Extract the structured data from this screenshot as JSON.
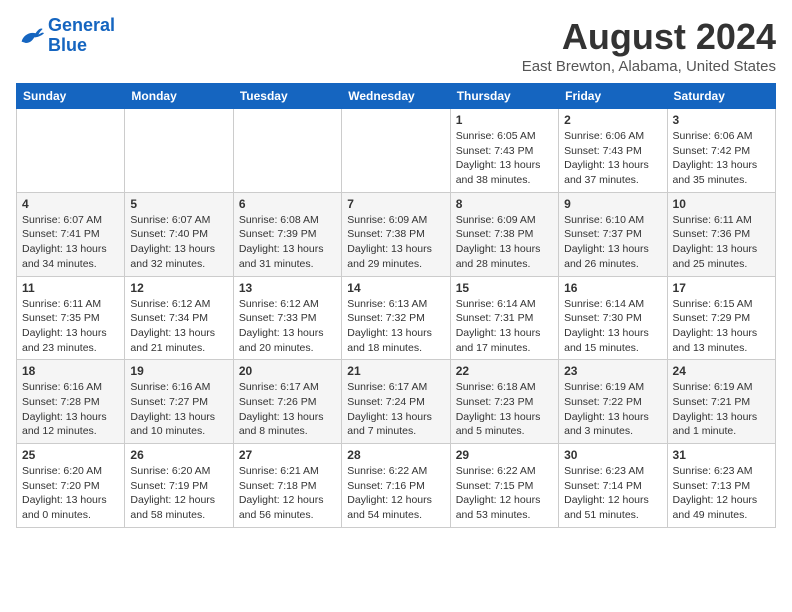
{
  "header": {
    "logo": {
      "line1": "General",
      "line2": "Blue"
    },
    "title": "August 2024",
    "subtitle": "East Brewton, Alabama, United States"
  },
  "weekdays": [
    "Sunday",
    "Monday",
    "Tuesday",
    "Wednesday",
    "Thursday",
    "Friday",
    "Saturday"
  ],
  "weeks": [
    [
      {
        "day": "",
        "info": ""
      },
      {
        "day": "",
        "info": ""
      },
      {
        "day": "",
        "info": ""
      },
      {
        "day": "",
        "info": ""
      },
      {
        "day": "1",
        "info": "Sunrise: 6:05 AM\nSunset: 7:43 PM\nDaylight: 13 hours\nand 38 minutes."
      },
      {
        "day": "2",
        "info": "Sunrise: 6:06 AM\nSunset: 7:43 PM\nDaylight: 13 hours\nand 37 minutes."
      },
      {
        "day": "3",
        "info": "Sunrise: 6:06 AM\nSunset: 7:42 PM\nDaylight: 13 hours\nand 35 minutes."
      }
    ],
    [
      {
        "day": "4",
        "info": "Sunrise: 6:07 AM\nSunset: 7:41 PM\nDaylight: 13 hours\nand 34 minutes."
      },
      {
        "day": "5",
        "info": "Sunrise: 6:07 AM\nSunset: 7:40 PM\nDaylight: 13 hours\nand 32 minutes."
      },
      {
        "day": "6",
        "info": "Sunrise: 6:08 AM\nSunset: 7:39 PM\nDaylight: 13 hours\nand 31 minutes."
      },
      {
        "day": "7",
        "info": "Sunrise: 6:09 AM\nSunset: 7:38 PM\nDaylight: 13 hours\nand 29 minutes."
      },
      {
        "day": "8",
        "info": "Sunrise: 6:09 AM\nSunset: 7:38 PM\nDaylight: 13 hours\nand 28 minutes."
      },
      {
        "day": "9",
        "info": "Sunrise: 6:10 AM\nSunset: 7:37 PM\nDaylight: 13 hours\nand 26 minutes."
      },
      {
        "day": "10",
        "info": "Sunrise: 6:11 AM\nSunset: 7:36 PM\nDaylight: 13 hours\nand 25 minutes."
      }
    ],
    [
      {
        "day": "11",
        "info": "Sunrise: 6:11 AM\nSunset: 7:35 PM\nDaylight: 13 hours\nand 23 minutes."
      },
      {
        "day": "12",
        "info": "Sunrise: 6:12 AM\nSunset: 7:34 PM\nDaylight: 13 hours\nand 21 minutes."
      },
      {
        "day": "13",
        "info": "Sunrise: 6:12 AM\nSunset: 7:33 PM\nDaylight: 13 hours\nand 20 minutes."
      },
      {
        "day": "14",
        "info": "Sunrise: 6:13 AM\nSunset: 7:32 PM\nDaylight: 13 hours\nand 18 minutes."
      },
      {
        "day": "15",
        "info": "Sunrise: 6:14 AM\nSunset: 7:31 PM\nDaylight: 13 hours\nand 17 minutes."
      },
      {
        "day": "16",
        "info": "Sunrise: 6:14 AM\nSunset: 7:30 PM\nDaylight: 13 hours\nand 15 minutes."
      },
      {
        "day": "17",
        "info": "Sunrise: 6:15 AM\nSunset: 7:29 PM\nDaylight: 13 hours\nand 13 minutes."
      }
    ],
    [
      {
        "day": "18",
        "info": "Sunrise: 6:16 AM\nSunset: 7:28 PM\nDaylight: 13 hours\nand 12 minutes."
      },
      {
        "day": "19",
        "info": "Sunrise: 6:16 AM\nSunset: 7:27 PM\nDaylight: 13 hours\nand 10 minutes."
      },
      {
        "day": "20",
        "info": "Sunrise: 6:17 AM\nSunset: 7:26 PM\nDaylight: 13 hours\nand 8 minutes."
      },
      {
        "day": "21",
        "info": "Sunrise: 6:17 AM\nSunset: 7:24 PM\nDaylight: 13 hours\nand 7 minutes."
      },
      {
        "day": "22",
        "info": "Sunrise: 6:18 AM\nSunset: 7:23 PM\nDaylight: 13 hours\nand 5 minutes."
      },
      {
        "day": "23",
        "info": "Sunrise: 6:19 AM\nSunset: 7:22 PM\nDaylight: 13 hours\nand 3 minutes."
      },
      {
        "day": "24",
        "info": "Sunrise: 6:19 AM\nSunset: 7:21 PM\nDaylight: 13 hours\nand 1 minute."
      }
    ],
    [
      {
        "day": "25",
        "info": "Sunrise: 6:20 AM\nSunset: 7:20 PM\nDaylight: 13 hours\nand 0 minutes."
      },
      {
        "day": "26",
        "info": "Sunrise: 6:20 AM\nSunset: 7:19 PM\nDaylight: 12 hours\nand 58 minutes."
      },
      {
        "day": "27",
        "info": "Sunrise: 6:21 AM\nSunset: 7:18 PM\nDaylight: 12 hours\nand 56 minutes."
      },
      {
        "day": "28",
        "info": "Sunrise: 6:22 AM\nSunset: 7:16 PM\nDaylight: 12 hours\nand 54 minutes."
      },
      {
        "day": "29",
        "info": "Sunrise: 6:22 AM\nSunset: 7:15 PM\nDaylight: 12 hours\nand 53 minutes."
      },
      {
        "day": "30",
        "info": "Sunrise: 6:23 AM\nSunset: 7:14 PM\nDaylight: 12 hours\nand 51 minutes."
      },
      {
        "day": "31",
        "info": "Sunrise: 6:23 AM\nSunset: 7:13 PM\nDaylight: 12 hours\nand 49 minutes."
      }
    ]
  ]
}
